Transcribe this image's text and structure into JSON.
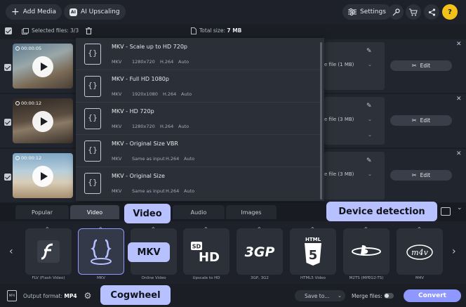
{
  "toolbar": {
    "add_media": "Add Media",
    "ai_upscaling": "AI Upscaling",
    "ai_badge": "AI",
    "settings": "Settings"
  },
  "selection": {
    "selected_label": "Selected files: 3/3",
    "total_label": "Total size: ",
    "total_value": "7 MB"
  },
  "files": [
    {
      "duration": "00:00:05",
      "size": "e file (1 MB)"
    },
    {
      "duration": "00:00:12",
      "size": "e file (3 MB)"
    },
    {
      "duration": "00:00:12",
      "size": "e file (3 MB)"
    }
  ],
  "edit_label": "Edit",
  "presets": [
    {
      "name": "MKV - Scale up to HD 720p",
      "format": "MKV",
      "resolution": "1280x720",
      "codec": "H.264",
      "bitrate": "Auto"
    },
    {
      "name": "MKV - Full HD 1080p",
      "format": "MKV",
      "resolution": "1920x1080",
      "codec": "H.264",
      "bitrate": "Auto"
    },
    {
      "name": "MKV - HD 720p",
      "format": "MKV",
      "resolution": "1280x720",
      "codec": "H.264",
      "bitrate": "Auto"
    },
    {
      "name": "MKV - Original Size VBR",
      "format": "MKV",
      "resolution": "Same as input",
      "codec": "H.264",
      "bitrate": "Auto"
    },
    {
      "name": "MKV - Original Size",
      "format": "MKV",
      "resolution": "Same as input",
      "codec": "H.264",
      "bitrate": "Auto"
    }
  ],
  "tabs": [
    {
      "label": "Popular",
      "active": false
    },
    {
      "label": "Video",
      "active": true
    },
    {
      "label": "Audio",
      "active": false
    },
    {
      "label": "Images",
      "active": false
    }
  ],
  "formats": [
    {
      "label": "FLV (Flash Video)",
      "icon": "flash-icon",
      "selected": false
    },
    {
      "label": "MKV",
      "icon": "mkv-icon",
      "selected": true
    },
    {
      "label": "Online Video",
      "icon": "online-video-icon",
      "selected": false
    },
    {
      "label": "Upscale to HD",
      "icon": "hd-icon",
      "selected": false
    },
    {
      "label": "3GP, 3G2",
      "icon": "3gp-icon",
      "selected": false
    },
    {
      "label": "HTML5 Video",
      "icon": "html5-icon",
      "selected": false
    },
    {
      "label": "M2TS (MPEG2-TS)",
      "icon": "bluray-icon",
      "selected": false
    },
    {
      "label": "M4V",
      "icon": "m4v-icon",
      "selected": false
    }
  ],
  "bottom": {
    "output_label": "Output format: ",
    "output_value": "MP4",
    "output_icon_text": "MP4",
    "save_to": "Save to...",
    "merge_files": "Merge files:",
    "convert": "Convert"
  },
  "callouts": {
    "video": "Video",
    "mkv": "MKV",
    "cogwheel": "Cogwheel",
    "device_detection": "Device detection"
  },
  "colors": {
    "accent": "#8e98ff",
    "callout": "#b8c1ff",
    "help": "#f3c21a",
    "background": "#1b1e25"
  }
}
